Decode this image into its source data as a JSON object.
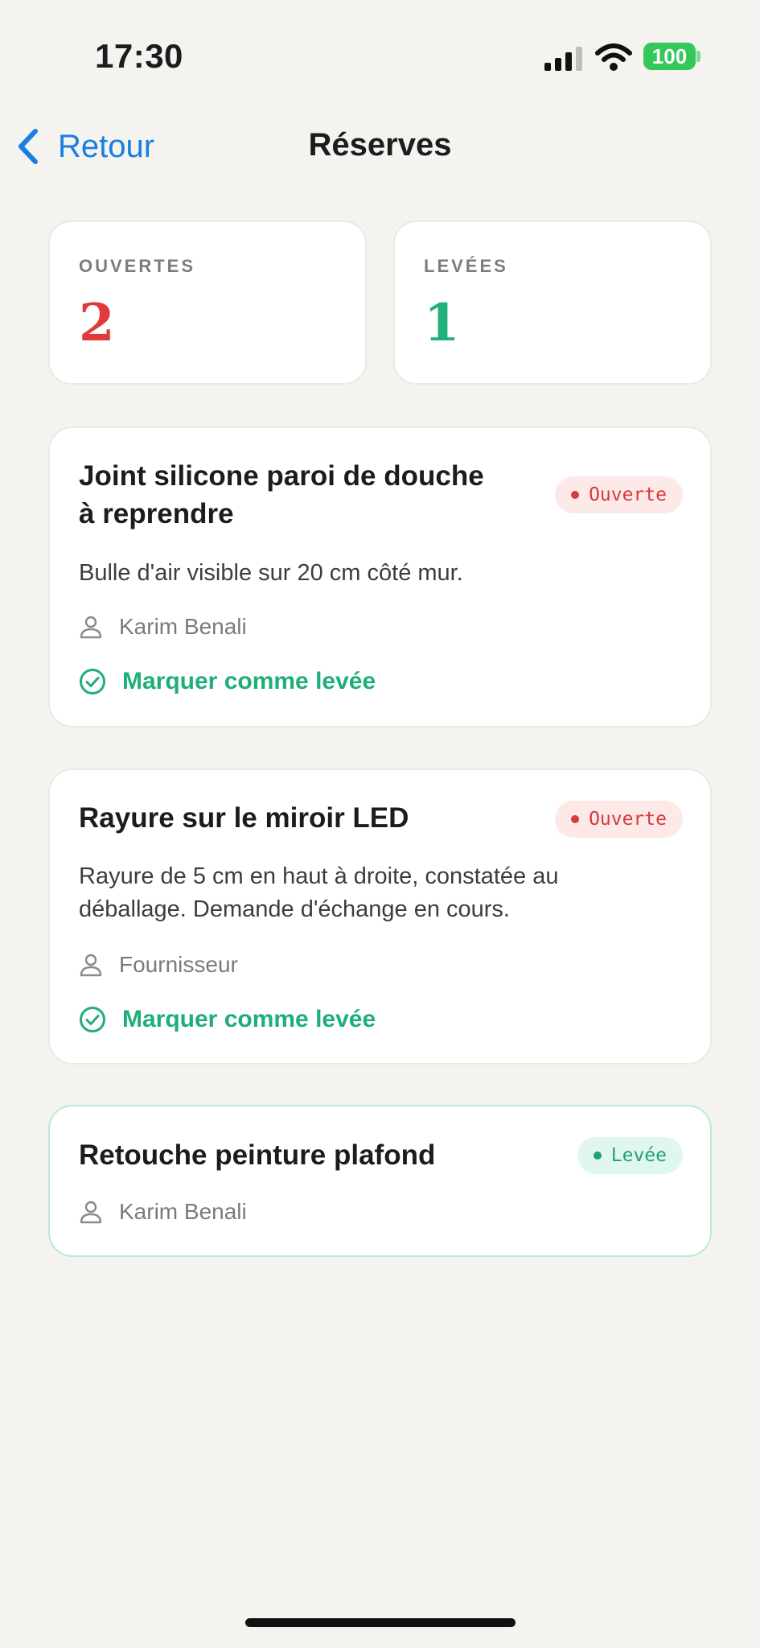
{
  "status_bar": {
    "time": "17:30",
    "battery": "100"
  },
  "nav": {
    "back_label": "Retour",
    "title": "Réserves"
  },
  "stats": {
    "open": {
      "label": "OUVERTES",
      "value": "2"
    },
    "lifted": {
      "label": "LEVÉES",
      "value": "1"
    }
  },
  "reserves": [
    {
      "title_line1": "Joint silicone paroi de douche",
      "title_line2": "à reprendre",
      "status": "Ouverte",
      "description": "Bulle d'air visible sur 20 cm côté mur.",
      "assignee": "Karim Benali",
      "action": "Marquer comme levée"
    },
    {
      "title": "Rayure sur le miroir LED",
      "status": "Ouverte",
      "description_line1": "Rayure de 5 cm en haut à droite, constatée au",
      "description_line2": "déballage. Demande d'échange en cours.",
      "assignee": "Fournisseur",
      "action": "Marquer comme levée"
    },
    {
      "title": "Retouche peinture plafond",
      "status": "Levée",
      "assignee": "Karim Benali"
    }
  ],
  "colors": {
    "accent_blue": "#1a7fe0",
    "open_red": "#e03a3a",
    "lifted_green": "#21b07a",
    "background": "#f4f3f0"
  },
  "icons": [
    "chevron-left-icon",
    "signal-icon",
    "wifi-icon",
    "battery-icon",
    "person-icon",
    "check-circle-icon"
  ]
}
